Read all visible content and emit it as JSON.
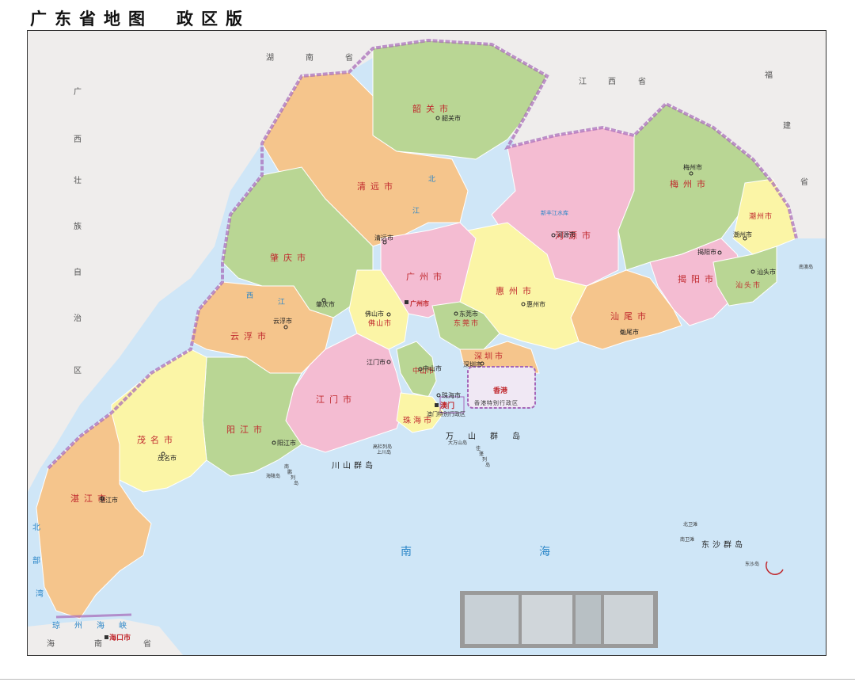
{
  "header": {
    "title": "广东省地图",
    "edition": "政区版"
  },
  "colors": {
    "sea": "#cfe6f7",
    "land_outside": "#efedec",
    "border": "#a566b8",
    "green": "#b9d694",
    "orange": "#f5c58c",
    "pink": "#f4bcd2",
    "yellow": "#fbf5a6"
  },
  "neighbors": [
    {
      "id": "hunan",
      "chars": [
        "湖",
        "南",
        "省"
      ]
    },
    {
      "id": "jiangxi",
      "chars": [
        "江",
        "西",
        "省"
      ]
    },
    {
      "id": "fujian",
      "chars": [
        "福",
        "建",
        "省"
      ]
    },
    {
      "id": "guangxi",
      "chars": [
        "广",
        "西",
        "壮",
        "族",
        "自",
        "治",
        "区"
      ]
    },
    {
      "id": "hainan",
      "chars": [
        "海",
        "南",
        "省"
      ]
    }
  ],
  "cities": [
    {
      "id": "shaoguan",
      "name": "韶关市",
      "seat": "韶关市"
    },
    {
      "id": "qingyuan",
      "name": "清远市",
      "seat": "清远市"
    },
    {
      "id": "heyuan",
      "name": "河源市",
      "seat": "河源市"
    },
    {
      "id": "meizhou",
      "name": "梅州市",
      "seat": "梅州市"
    },
    {
      "id": "chaozhou",
      "name": "潮州市",
      "seat": "潮州市"
    },
    {
      "id": "jieyang",
      "name": "揭阳市",
      "seat": "揭阳市"
    },
    {
      "id": "shantou",
      "name": "汕头市",
      "seat": "汕头市"
    },
    {
      "id": "shanwei",
      "name": "汕尾市",
      "seat": "汕尾市"
    },
    {
      "id": "huizhou",
      "name": "惠州市",
      "seat": "惠州市"
    },
    {
      "id": "zhaoqing",
      "name": "肇庆市",
      "seat": "肇庆市"
    },
    {
      "id": "guangzhou",
      "name": "广州市",
      "seat": "广州市"
    },
    {
      "id": "foshan",
      "name": "佛山市",
      "seat": "佛山市"
    },
    {
      "id": "dongguan",
      "name": "东莞市",
      "seat": "东莞市"
    },
    {
      "id": "yunfu",
      "name": "云浮市",
      "seat": "云浮市"
    },
    {
      "id": "jiangmen",
      "name": "江门市",
      "seat": "江门市"
    },
    {
      "id": "zhongshan",
      "name": "中山市",
      "seat": "中山市"
    },
    {
      "id": "shenzhen",
      "name": "深圳市",
      "seat": "深圳市"
    },
    {
      "id": "zhuhai",
      "name": "珠海市",
      "seat": "珠海市"
    },
    {
      "id": "yangjiang",
      "name": "阳江市",
      "seat": "阳江市"
    },
    {
      "id": "maoming",
      "name": "茂名市",
      "seat": "茂名市"
    },
    {
      "id": "zhanjiang",
      "name": "湛江市",
      "seat": "湛江市"
    }
  ],
  "special_regions": [
    {
      "id": "hongkong",
      "name": "香港",
      "caption": "香港特别行政区"
    },
    {
      "id": "macau",
      "name": "澳门",
      "caption": "澳门特别行政区"
    }
  ],
  "water": {
    "sea": "南",
    "sea2": "海",
    "strait": [
      "琼",
      "州",
      "海",
      "峡"
    ],
    "xi_river": [
      "西",
      "江"
    ],
    "north_river": [
      "北",
      "江"
    ],
    "reservoir": "新丰江水库",
    "gulf": [
      "北",
      "部",
      "湾"
    ]
  },
  "islands": {
    "wanshan": [
      "万",
      "山",
      "群",
      "岛"
    ],
    "chuanshan": [
      "川",
      "山",
      "群",
      "岛"
    ],
    "dongsha": "东沙群岛",
    "nanpeng": [
      "南",
      "鹏",
      "列",
      "岛"
    ],
    "shangchuan": "上川岛",
    "gaolan": "高栏列岛",
    "hailing": "海陵岛",
    "nanao": "南澳岛",
    "dawan": "大万山岛",
    "jiapeng": [
      "佳",
      "蓬",
      "列",
      "岛"
    ],
    "dongsha_island": "东沙岛",
    "beiwei": "北卫滩",
    "nanwei": "南卫滩"
  },
  "inset": {
    "panels": 4
  }
}
